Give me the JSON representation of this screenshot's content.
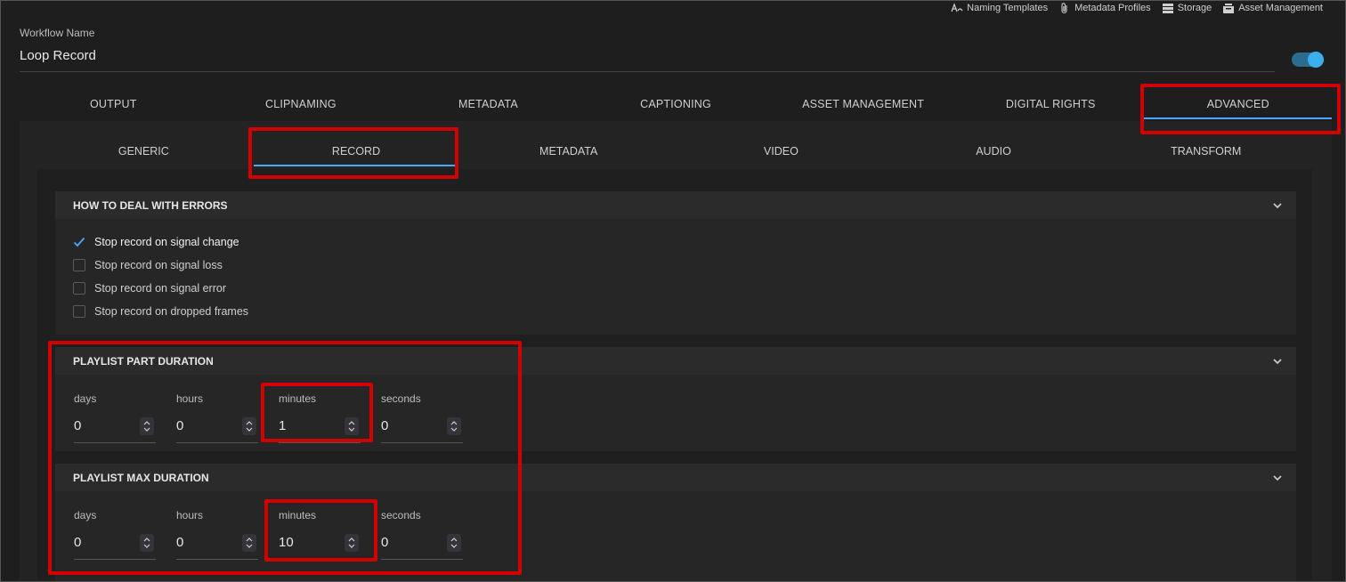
{
  "top_links": [
    {
      "label": "Naming Templates",
      "icon": "naming-templates-icon"
    },
    {
      "label": "Metadata Profiles",
      "icon": "paperclip-icon"
    },
    {
      "label": "Storage",
      "icon": "storage-icon"
    },
    {
      "label": "Asset Management",
      "icon": "asset-management-icon"
    }
  ],
  "workflow": {
    "label": "Workflow Name",
    "name": "Loop Record",
    "enabled": true
  },
  "main_tabs": [
    "OUTPUT",
    "CLIPNAMING",
    "METADATA",
    "CAPTIONING",
    "ASSET MANAGEMENT",
    "DIGITAL RIGHTS",
    "ADVANCED"
  ],
  "main_tab_active": "ADVANCED",
  "sub_tabs": [
    "GENERIC",
    "RECORD",
    "METADATA",
    "VIDEO",
    "AUDIO",
    "TRANSFORM"
  ],
  "sub_tab_active": "RECORD",
  "errors_section": {
    "title": "HOW TO DEAL WITH ERRORS",
    "options": [
      {
        "label": "Stop record on signal change",
        "checked": true
      },
      {
        "label": "Stop record on signal loss",
        "checked": false
      },
      {
        "label": "Stop record on signal error",
        "checked": false
      },
      {
        "label": "Stop record on dropped frames",
        "checked": false
      }
    ]
  },
  "part_duration": {
    "title": "PLAYLIST PART DURATION",
    "fields": [
      {
        "label": "days",
        "value": "0"
      },
      {
        "label": "hours",
        "value": "0"
      },
      {
        "label": "minutes",
        "value": "1"
      },
      {
        "label": "seconds",
        "value": "0"
      }
    ]
  },
  "max_duration": {
    "title": "PLAYLIST MAX DURATION",
    "fields": [
      {
        "label": "days",
        "value": "0"
      },
      {
        "label": "hours",
        "value": "0"
      },
      {
        "label": "minutes",
        "value": "10"
      },
      {
        "label": "seconds",
        "value": "0"
      }
    ]
  },
  "colors": {
    "accent": "#4aa8ff",
    "highlight": "#d40000",
    "background": "#1e1e1e"
  }
}
